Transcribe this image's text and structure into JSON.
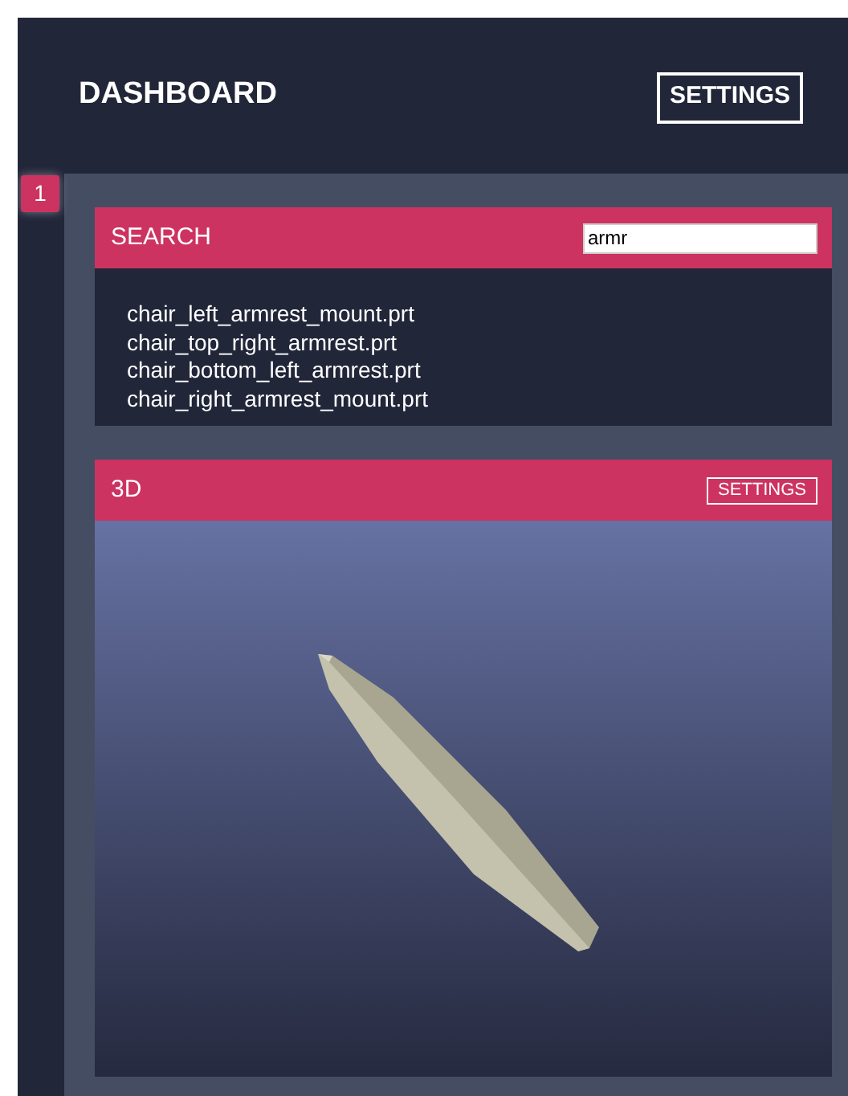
{
  "header": {
    "title": "DASHBOARD",
    "settings_button": "SETTINGS"
  },
  "badge": "1",
  "search_panel": {
    "title": "SEARCH",
    "query": "armr",
    "results": [
      "chair_left_armrest_mount.prt",
      "chair_top_right_armrest.prt",
      "chair_bottom_left_armrest.prt",
      "chair_right_armrest_mount.prt"
    ]
  },
  "viewer_panel": {
    "title": "3D",
    "settings_button": "SETTINGS"
  }
}
